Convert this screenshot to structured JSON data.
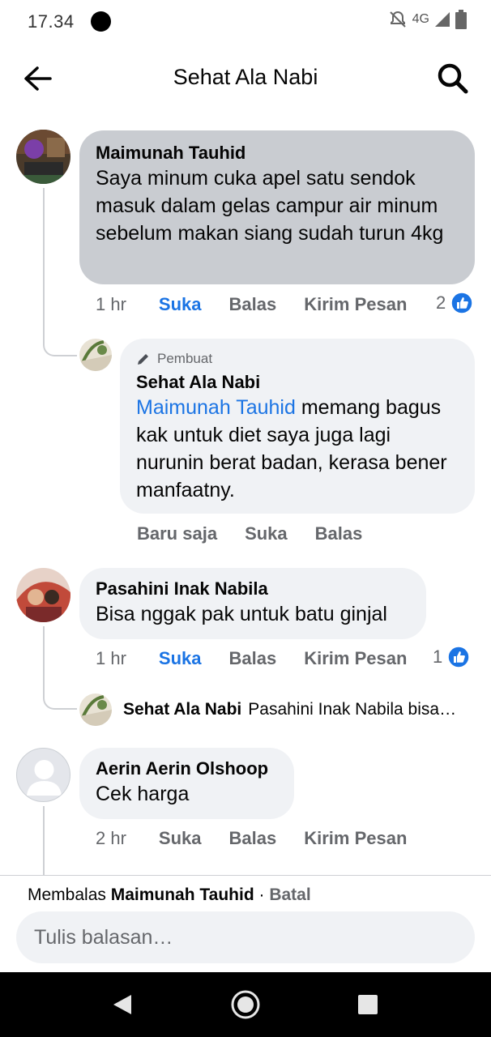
{
  "status": {
    "time": "17.34",
    "network": "4G"
  },
  "header": {
    "title": "Sehat Ala Nabi"
  },
  "comments": [
    {
      "author": "Maimunah Tauhid",
      "text": "Saya minum cuka apel satu sendok masuk dalam gelas campur air minum sebelum makan siang sudah turun 4kg",
      "time": "1 hr",
      "like_label": "Suka",
      "reply_label": "Balas",
      "message_label": "Kirim Pesan",
      "likes": "2",
      "reply": {
        "author_tag": "Pembuat",
        "author": "Sehat Ala Nabi",
        "mention": "Maimunah Tauhid",
        "text": " memang bagus kak untuk diet saya juga lagi nurunin berat badan, kerasa bener manfaatny.",
        "time": "Baru saja",
        "like_label": "Suka",
        "reply_label": "Balas"
      }
    },
    {
      "author": "Pasahini Inak Nabila",
      "text": "Bisa nggak pak untuk batu ginjal",
      "time": "1 hr",
      "like_label": "Suka",
      "reply_label": "Balas",
      "message_label": "Kirim Pesan",
      "likes": "1",
      "collapsed_reply": {
        "author": "Sehat Ala Nabi",
        "preview": "Pasahini Inak Nabila bisa…"
      }
    },
    {
      "author": "Aerin Aerin Olshoop",
      "text": "Cek harga",
      "time": "2 hr",
      "like_label": "Suka",
      "reply_label": "Balas",
      "message_label": "Kirim Pesan"
    }
  ],
  "composer": {
    "replying_prefix": "Membalas ",
    "replying_to": "Maimunah Tauhid",
    "separator": " · ",
    "cancel_label": "Batal",
    "placeholder": "Tulis balasan…"
  },
  "colors": {
    "accent": "#1b74e4",
    "bubble_grey": "#c9ccd1",
    "bubble_light": "#f0f2f5",
    "meta_text": "#65676b"
  }
}
